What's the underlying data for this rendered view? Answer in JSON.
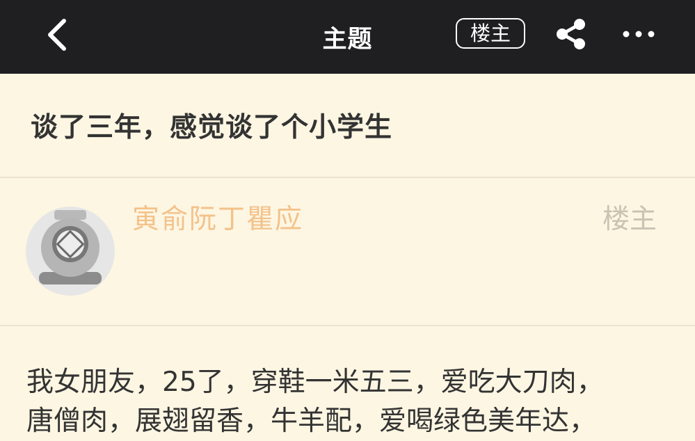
{
  "header": {
    "title": "主题",
    "op_badge": "楼主",
    "icons": {
      "back": "chevron-left-icon",
      "share": "share-icon",
      "more": "more-icon"
    }
  },
  "post": {
    "title": "谈了三年，感觉谈了个小学生",
    "author": {
      "name": "寅俞阮丁瞿应",
      "role": "楼主",
      "avatar_icon": "diving-helmet-avatar"
    },
    "body_lines": [
      "我女朋友，25了，穿鞋一米五三，爱吃大刀肉，",
      "唐僧肉，展翅留香，牛羊配，爱喝绿色美年达，"
    ]
  },
  "colors": {
    "topbar": "#1f1f22",
    "background": "#fdf6e3",
    "username": "#f3c28a",
    "muted": "#c9c3b3"
  }
}
